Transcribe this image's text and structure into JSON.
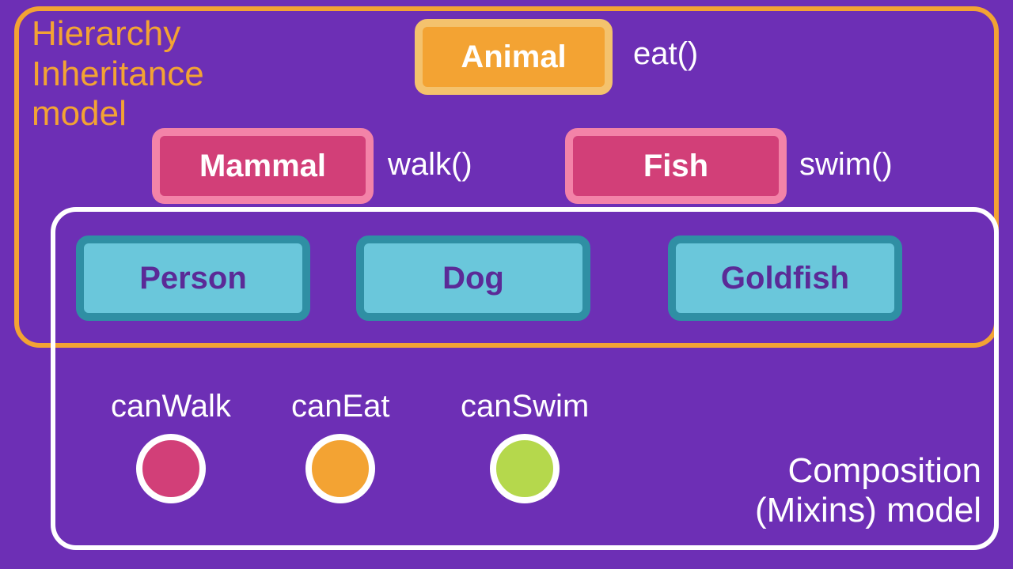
{
  "titles": {
    "hierarchy": "Hierarchy\nInheritance\nmodel",
    "composition": "Composition\n(Mixins) model"
  },
  "nodes": {
    "animal": {
      "label": "Animal",
      "method": "eat()"
    },
    "mammal": {
      "label": "Mammal",
      "method": "walk()"
    },
    "fish": {
      "label": "Fish",
      "method": "swim()"
    },
    "person": {
      "label": "Person"
    },
    "dog": {
      "label": "Dog"
    },
    "goldfish": {
      "label": "Goldfish"
    }
  },
  "mixins": [
    {
      "label": "canWalk",
      "color": "pink"
    },
    {
      "label": "canEat",
      "color": "yellow"
    },
    {
      "label": "canSwim",
      "color": "green"
    }
  ],
  "colors": {
    "bg": "#6d2fb5",
    "orange": "#f3a333",
    "pink": "#d23f78",
    "teal": "#6ac7db",
    "green": "#b5d84c",
    "white": "#ffffff"
  }
}
